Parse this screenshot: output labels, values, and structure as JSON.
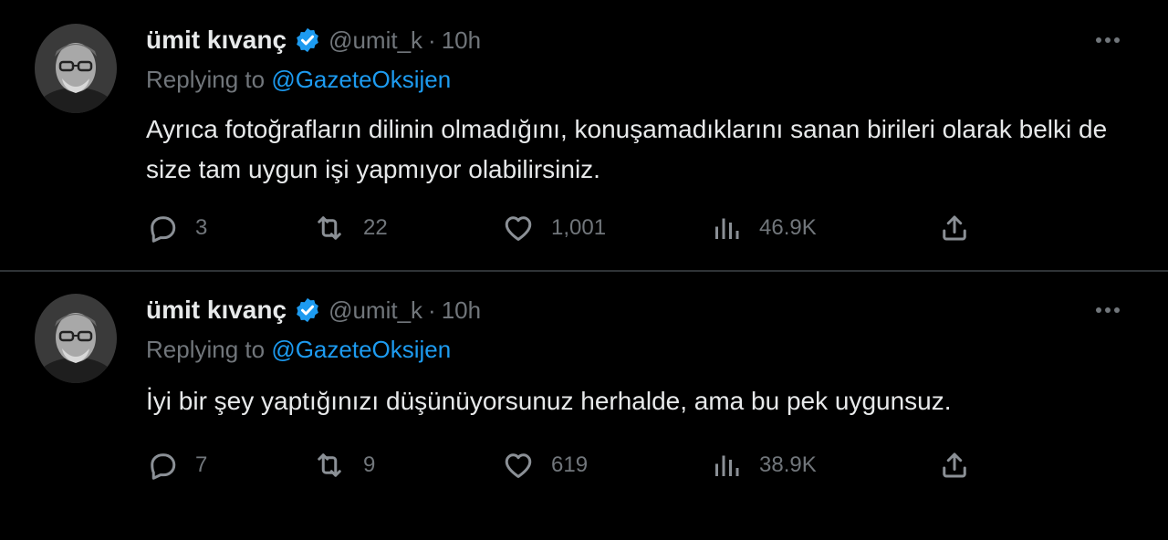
{
  "colors": {
    "background": "#000000",
    "text": "#e7e9ea",
    "muted": "#71767b",
    "accent": "#1d9bf0",
    "divider": "#2f3336"
  },
  "tweets": [
    {
      "author": {
        "name": "ümit kıvanç",
        "handle": "@umit_k",
        "verified_icon": "verified-badge-icon",
        "avatar": "avatar"
      },
      "separator": "·",
      "time": "10h",
      "replying_prefix": "Replying to",
      "replying_to": "@GazeteOksijen",
      "text": "Ayrıca fotoğrafların dilinin olmadığını, konuşamadıklarını sanan birileri olarak belki de size tam uygun işi yapmıyor olabilirsiniz.",
      "stats": {
        "replies": "3",
        "retweets": "22",
        "likes": "1,001",
        "views": "46.9K"
      }
    },
    {
      "author": {
        "name": "ümit kıvanç",
        "handle": "@umit_k",
        "verified_icon": "verified-badge-icon",
        "avatar": "avatar"
      },
      "separator": "·",
      "time": "10h",
      "replying_prefix": "Replying to",
      "replying_to": "@GazeteOksijen",
      "text": "İyi bir şey yaptığınızı düşünüyorsunuz herhalde, ama bu pek uygunsuz.",
      "stats": {
        "replies": "7",
        "retweets": "9",
        "likes": "619",
        "views": "38.9K"
      }
    }
  ]
}
